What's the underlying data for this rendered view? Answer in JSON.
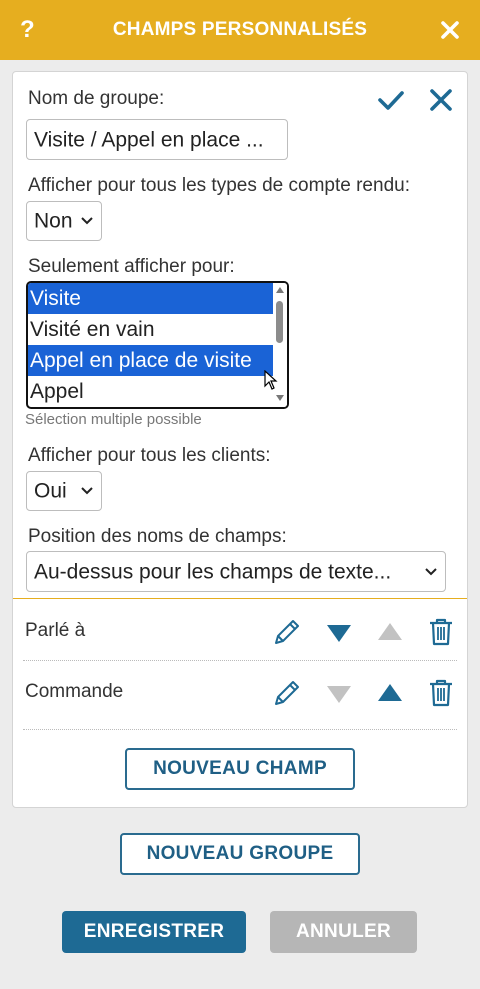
{
  "header": {
    "title": "CHAMPS PERSONNALISÉS",
    "help": "?"
  },
  "group": {
    "name_label": "Nom de groupe:",
    "name_value": "Visite / Appel en place ...",
    "all_types_label": "Afficher pour tous les types de compte rendu:",
    "all_types_value": "Non",
    "only_show_label": "Seulement afficher pour:",
    "only_show_options": [
      {
        "label": "Visite",
        "selected": true
      },
      {
        "label": "Visité en vain",
        "selected": false
      },
      {
        "label": "Appel en place de visite",
        "selected": true
      },
      {
        "label": "Appel",
        "selected": false
      }
    ],
    "multi_hint": "Sélection multiple possible",
    "all_clients_label": "Afficher pour tous les clients:",
    "all_clients_value": "Oui",
    "position_label": "Position des noms de champs:",
    "position_value": "Au-dessus pour les champs de texte..."
  },
  "fields": [
    {
      "name": "Parlé à",
      "move_down_enabled": true,
      "move_up_enabled": false
    },
    {
      "name": "Commande",
      "move_down_enabled": false,
      "move_up_enabled": true
    }
  ],
  "buttons": {
    "new_field": "NOUVEAU CHAMP",
    "new_group": "NOUVEAU GROUPE",
    "save": "ENREGISTRER",
    "cancel": "ANNULER"
  },
  "colors": {
    "header": "#e6ae1f",
    "accent": "#1e6a94",
    "selection": "#1a63d6",
    "disabled": "#b6b6b6"
  }
}
